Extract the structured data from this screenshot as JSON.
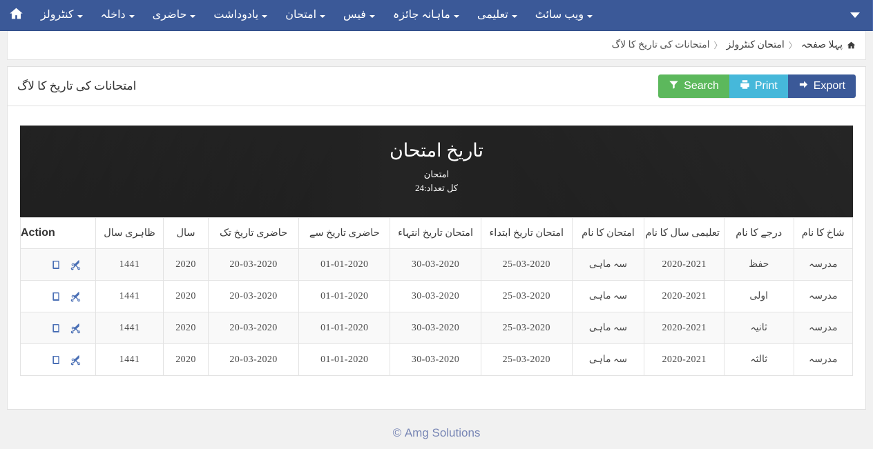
{
  "navbar": {
    "home_icon": "home-icon",
    "toggle_icon": "chevron-down-icon",
    "items": [
      {
        "label": "کنٹرولز",
        "caret": "caret-down-icon"
      },
      {
        "label": "داخلہ",
        "caret": "caret-down-icon"
      },
      {
        "label": "حاضری",
        "caret": "caret-down-icon"
      },
      {
        "label": "یادوداشت",
        "caret": "caret-down-icon"
      },
      {
        "label": "امتحان",
        "caret": "caret-down-icon"
      },
      {
        "label": "فیس",
        "caret": "caret-down-icon"
      },
      {
        "label": "ماہانہ جائزہ",
        "caret": "caret-down-icon"
      },
      {
        "label": "تعلیمی",
        "caret": "caret-down-icon"
      },
      {
        "label": "ویب سائٹ",
        "caret": "caret-down-icon"
      }
    ],
    "background_color": "#3b5998"
  },
  "breadcrumb": {
    "home_icon": "home-icon",
    "items": [
      {
        "label": "پہلا صفحہ",
        "active": false
      },
      {
        "label": "امتحان کنٹرولز",
        "active": false
      },
      {
        "label": "امتحانات کی تاریخ کا لاگ",
        "active": true
      }
    ],
    "separator": "〈"
  },
  "toolbar": {
    "page_title": "امتحانات کی تاریخ کا لاگ",
    "search_label": "Search",
    "search_icon": "filter-icon",
    "search_color": "#5cb85c",
    "print_label": "Print",
    "print_icon": "printer-icon",
    "print_color": "#46b8da",
    "export_label": "Export",
    "export_icon": "arrow-right-icon",
    "export_color": "#3b5998"
  },
  "report": {
    "title": "تاریخ امتحان",
    "subtitle": "امتحان",
    "total_label": "کل تعداد:24",
    "total_count": 24,
    "banner_color": "#1b1b1b"
  },
  "table": {
    "headers": {
      "action": "Action",
      "hijri_year": "ظاہری سال",
      "year": "سال",
      "attendance_to": "حاضری تاریخ تک",
      "attendance_from": "حاضری تاریخ سے",
      "exam_end": "امتحان تاریخ انتہاء",
      "exam_start": "امتحان تاریخ ابتداء",
      "exam_name": "امتحان کا نام",
      "session_name": "تعلیمی سال کا نام",
      "grade_name": "درجے کا نام",
      "branch_name": "شاخ کا نام"
    },
    "row_icons": {
      "detail": "book-icon",
      "cut": "scissors-icon"
    },
    "rows": [
      {
        "branch_name": "مدرسہ",
        "grade_name": "حفظ",
        "session_name": "2020-2021",
        "exam_name": "سہ ماہی",
        "exam_start": "25-03-2020",
        "exam_end": "30-03-2020",
        "attendance_from": "01-01-2020",
        "attendance_to": "20-03-2020",
        "year": "2020",
        "hijri_year": "1441"
      },
      {
        "branch_name": "مدرسہ",
        "grade_name": "اولی",
        "session_name": "2020-2021",
        "exam_name": "سہ ماہی",
        "exam_start": "25-03-2020",
        "exam_end": "30-03-2020",
        "attendance_from": "01-01-2020",
        "attendance_to": "20-03-2020",
        "year": "2020",
        "hijri_year": "1441"
      },
      {
        "branch_name": "مدرسہ",
        "grade_name": "ثانیہ",
        "session_name": "2020-2021",
        "exam_name": "سہ ماہی",
        "exam_start": "25-03-2020",
        "exam_end": "30-03-2020",
        "attendance_from": "01-01-2020",
        "attendance_to": "20-03-2020",
        "year": "2020",
        "hijri_year": "1441"
      },
      {
        "branch_name": "مدرسہ",
        "grade_name": "ثالثہ",
        "session_name": "2020-2021",
        "exam_name": "سہ ماہی",
        "exam_start": "25-03-2020",
        "exam_end": "30-03-2020",
        "attendance_from": "01-01-2020",
        "attendance_to": "20-03-2020",
        "year": "2020",
        "hijri_year": "1441"
      }
    ]
  },
  "footer": {
    "text": "Amg Solutions ©"
  }
}
